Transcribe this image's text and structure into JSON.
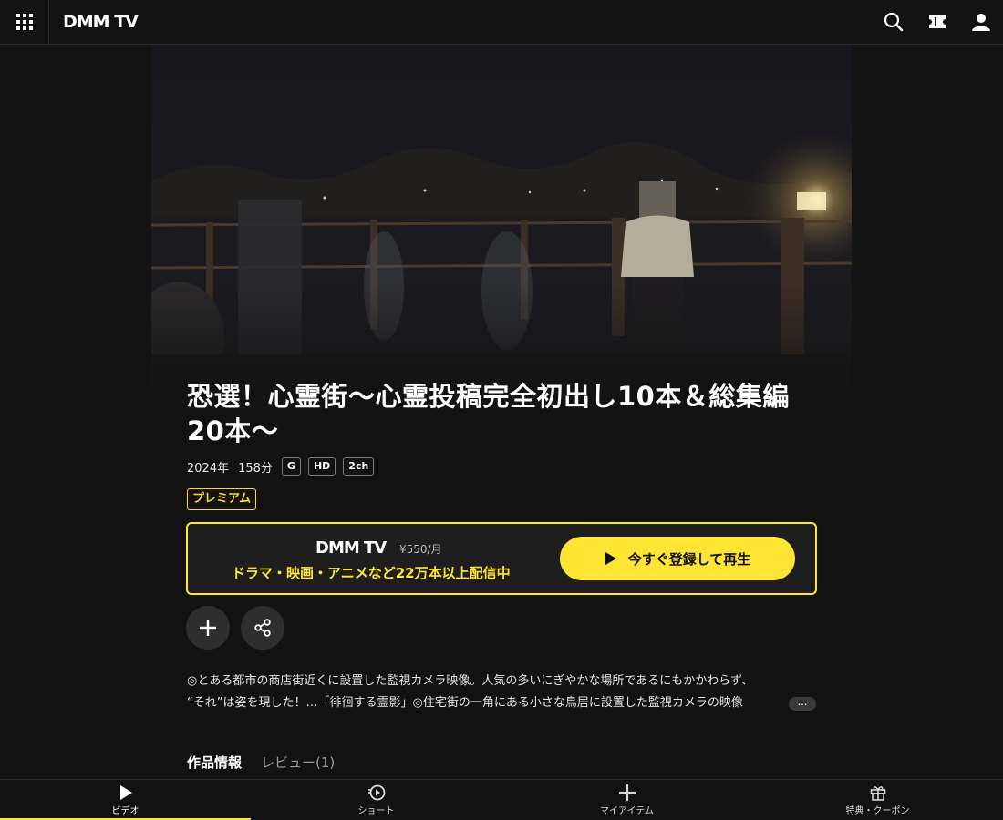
{
  "header": {
    "logo": "DMM TV",
    "icons": [
      "apps-grid-icon",
      "search-icon",
      "ticket-icon",
      "account-icon"
    ]
  },
  "title": "恐選！心霊街～心霊投稿完全初出し10本＆総集編20本～",
  "meta": {
    "year": "2024年",
    "duration": "158分",
    "badges": [
      "G",
      "HD",
      "2ch"
    ]
  },
  "premium_label": "プレミアム",
  "promo": {
    "logo": "DMM TV",
    "price": "¥550/月",
    "copy": "ドラマ・映画・アニメなど22万本以上配信中",
    "button_label": "今すぐ登録して再生"
  },
  "description": {
    "line1": "◎とある都市の商店街近くに設置した監視カメラ映像。人気の多いにぎやかな場所であるにもかかわらず、",
    "line2": "“それ”は姿を現した！…「徘徊する霊影」◎住宅街の一角にある小さな鳥居に設置した監視カメラの映像",
    "more": "…"
  },
  "tabs": {
    "info": "作品情報",
    "review": "レビュー(1)"
  },
  "bottom_nav": [
    {
      "label": "ビデオ",
      "icon": "play-icon",
      "active": true
    },
    {
      "label": "ショート",
      "icon": "short-video-icon",
      "active": false
    },
    {
      "label": "マイアイテム",
      "icon": "plus-icon",
      "active": false
    },
    {
      "label": "特典・クーポン",
      "icon": "gift-icon",
      "active": false
    }
  ],
  "colors": {
    "accent": "#ffe533",
    "background": "#121212"
  }
}
